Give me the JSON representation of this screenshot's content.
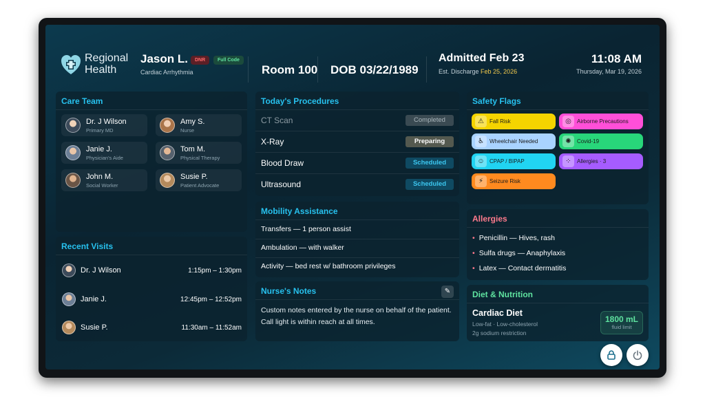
{
  "brand": {
    "line1": "Regional",
    "line2": "Health"
  },
  "patient": {
    "name": "Jason L.",
    "badges": {
      "dnr": "DNR",
      "full_code": "Full Code"
    },
    "diagnosis": "Cardiac Arrhythmia"
  },
  "room": "Room 100",
  "dob": "DOB 03/22/1989",
  "admission": {
    "admitted": "Admitted Feb 23",
    "discharge_label": "Est. Discharge ",
    "discharge_date": "Feb 25, 2026"
  },
  "clock": {
    "time": "11:08 AM",
    "date": "Thursday, Mar 19, 2026"
  },
  "care_team": {
    "title": "Care Team",
    "members": [
      {
        "name": "Dr. J Wilson",
        "role": "Primary MD"
      },
      {
        "name": "Amy S.",
        "role": "Nurse"
      },
      {
        "name": "Janie J.",
        "role": "Physician's Aide"
      },
      {
        "name": "Tom M.",
        "role": "Physical Therapy"
      },
      {
        "name": "John M.",
        "role": "Social Worker"
      },
      {
        "name": "Susie P.",
        "role": "Patient Advocate"
      }
    ]
  },
  "recent_visits": {
    "title": "Recent Visits",
    "items": [
      {
        "name": "Dr. J Wilson",
        "time": "1:15pm – 1:30pm"
      },
      {
        "name": "Janie J.",
        "time": "12:45pm – 12:52pm"
      },
      {
        "name": "Susie P.",
        "time": "11:30am – 11:52am"
      }
    ]
  },
  "procedures": {
    "title": "Today's Procedures",
    "items": [
      {
        "name": "CT Scan",
        "status": "Completed"
      },
      {
        "name": "X-Ray",
        "status": "Preparing"
      },
      {
        "name": "Blood Draw",
        "status": "Scheduled"
      },
      {
        "name": "Ultrasound",
        "status": "Scheduled"
      }
    ]
  },
  "mobility": {
    "title": "Mobility Assistance",
    "items": [
      "Transfers — 1 person assist",
      "Ambulation — with walker",
      "Activity — bed rest w/ bathroom privileges"
    ]
  },
  "notes": {
    "title": "Nurse's Notes",
    "text": "Custom notes entered by the nurse on behalf of the patient. Call light is within reach at all times."
  },
  "safety_flags": {
    "title": "Safety Flags",
    "items": [
      {
        "label": "Fall Risk",
        "icon": "fall-risk-icon",
        "color": "#f5d400"
      },
      {
        "label": "Airborne Precautions",
        "icon": "mask-icon",
        "color": "#ff4fd8"
      },
      {
        "label": "Wheelchair Needed",
        "icon": "wheelchair-icon",
        "color": "#a9d3ff"
      },
      {
        "label": "Covid-19",
        "icon": "virus-icon",
        "color": "#28d67a"
      },
      {
        "label": "CPAP / BIPAP",
        "icon": "cpap-icon",
        "color": "#21d4f2"
      },
      {
        "label": "Allergies · 3",
        "icon": "allergy-icon",
        "color": "#a65cff"
      },
      {
        "label": "Seizure Risk",
        "icon": "lightning-icon",
        "color": "#ff8a1f"
      }
    ]
  },
  "allergies": {
    "title": "Allergies",
    "items": [
      "Penicillin — Hives, rash",
      "Sulfa drugs — Anaphylaxis",
      "Latex — Contact dermatitis"
    ]
  },
  "diet": {
    "title": "Diet & Nutrition",
    "name": "Cardiac Diet",
    "line1": "Low-fat · Low-cholesterol",
    "line2": "2g sodium restriction",
    "fluid_value": "1800 mL",
    "fluid_label": "fluid limit"
  },
  "icons": {
    "lock": "lock-icon",
    "power": "power-icon"
  }
}
